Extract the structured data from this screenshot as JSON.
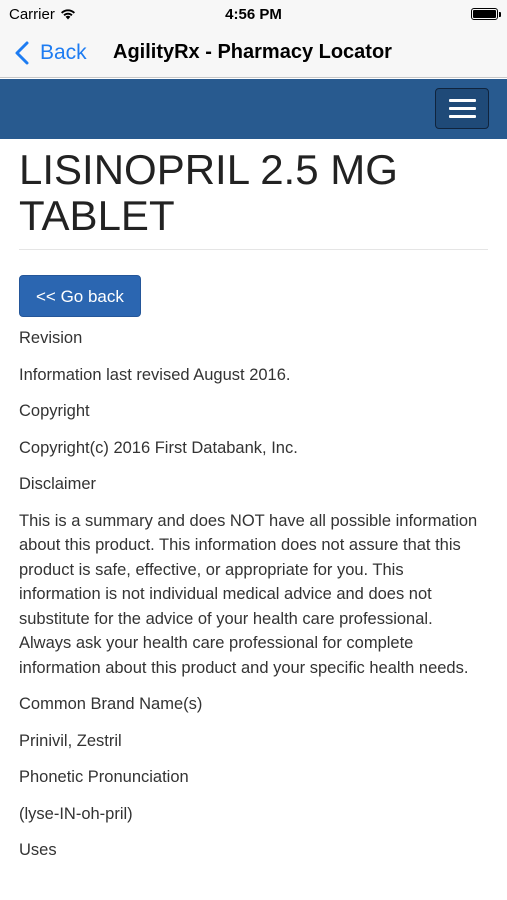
{
  "status_bar": {
    "carrier": "Carrier",
    "time": "4:56 PM"
  },
  "nav_bar": {
    "back_label": "Back",
    "title": "AgilityRx - Pharmacy Locator",
    "accent_color": "#1d7cf2"
  },
  "header": {
    "background_color": "#285a8f",
    "menu_icon": "hamburger-menu-icon"
  },
  "page": {
    "title": "LISINOPRIL 2.5 MG TABLET",
    "go_back_label": "<< Go back",
    "sections": [
      "Revision",
      "Information last revised August 2016.",
      "Copyright",
      "Copyright(c) 2016 First Databank, Inc.",
      "Disclaimer",
      "This is a summary and does NOT have all possible information about this product.  This information does not assure that this product is safe, effective, or appropriate for you.  This information is not individual medical advice and does not substitute for the advice of your health care professional.  Always ask your health care professional for complete information about this product and your specific health needs.",
      "Common Brand Name(s)",
      "Prinivil, Zestril",
      "Phonetic Pronunciation",
      "(lyse-IN-oh-pril)",
      "Uses"
    ]
  }
}
